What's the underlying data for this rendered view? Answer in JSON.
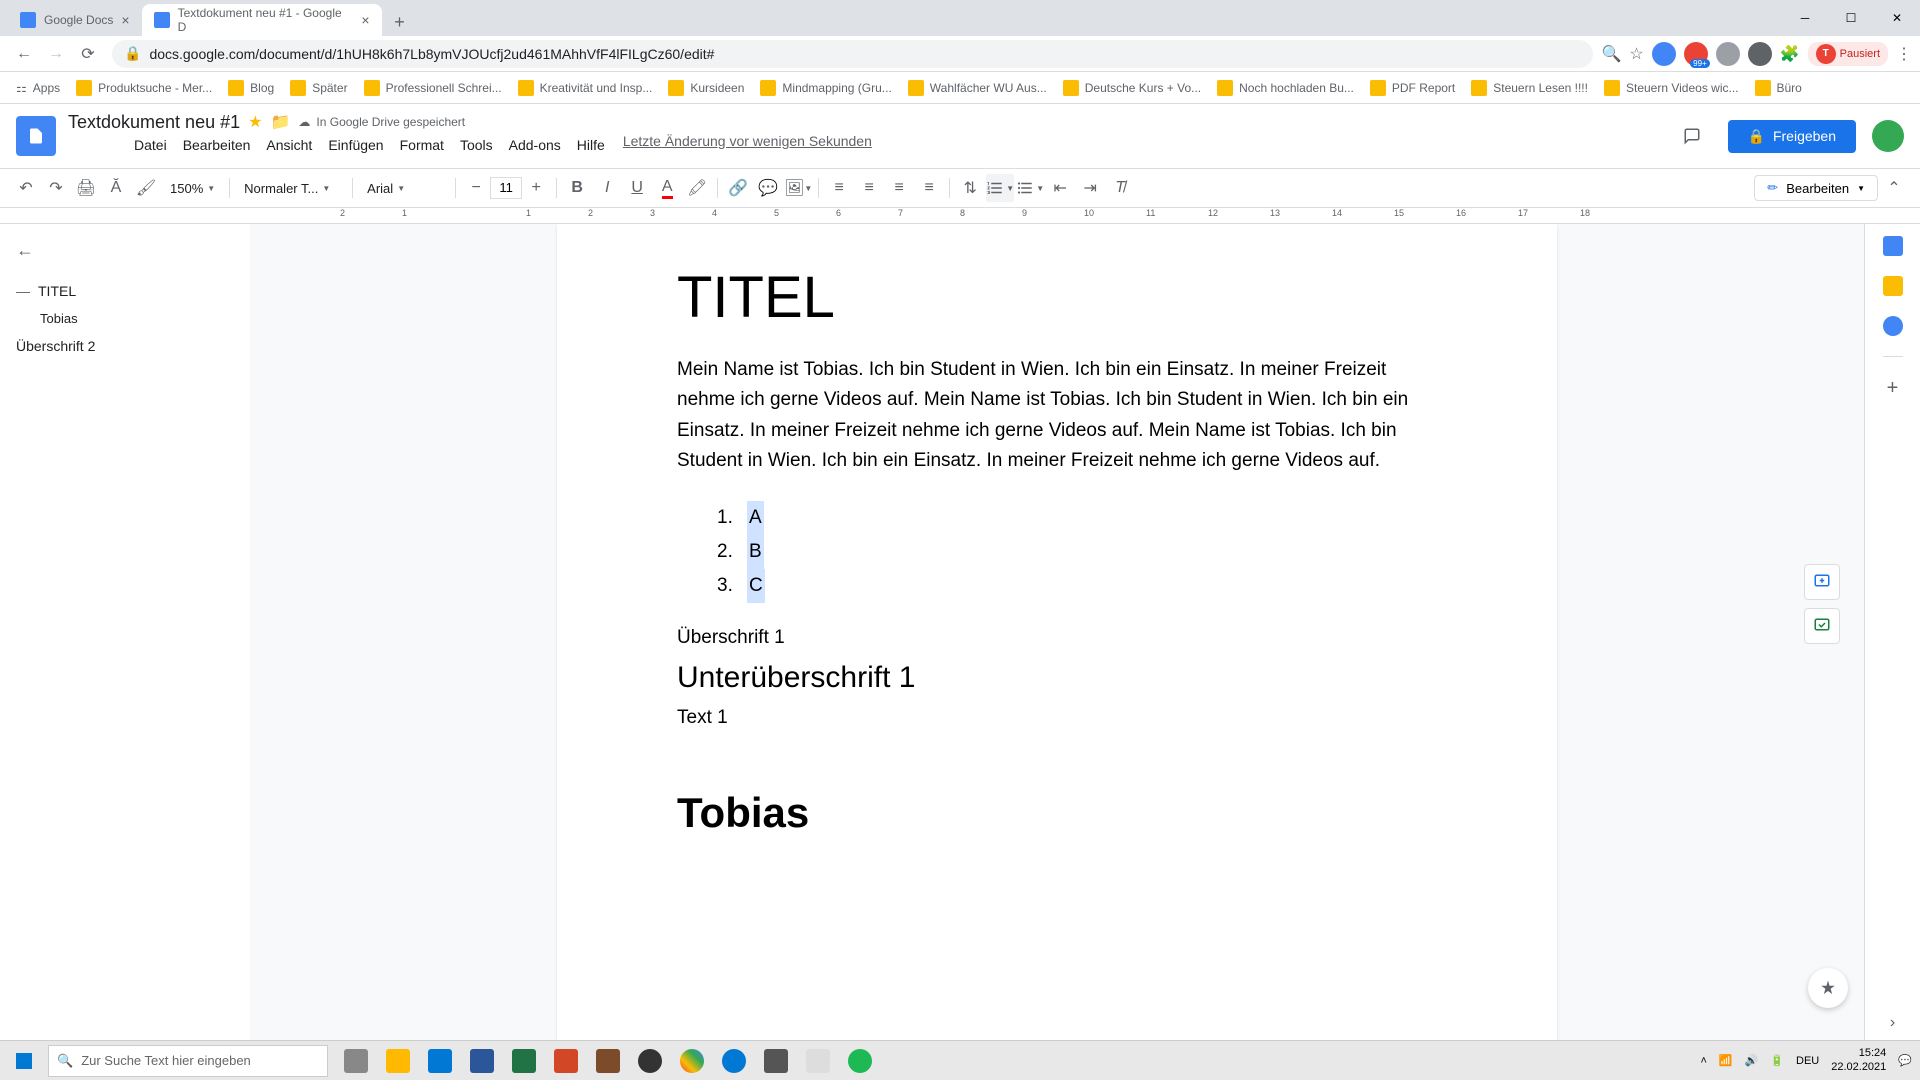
{
  "browser": {
    "tabs": [
      {
        "title": "Google Docs",
        "active": false
      },
      {
        "title": "Textdokument neu #1 - Google D",
        "active": true
      }
    ],
    "url": "docs.google.com/document/d/1hUH8k6h7Lb8ymVJOUcfj2ud461MAhhVfF4lFILgCz60/edit#",
    "pause_label": "Pausiert",
    "pause_initial": "T"
  },
  "bookmarks": [
    "Apps",
    "Produktsuche - Mer...",
    "Blog",
    "Später",
    "Professionell Schrei...",
    "Kreativität und Insp...",
    "Kursideen",
    "Mindmapping (Gru...",
    "Wahlfächer WU Aus...",
    "Deutsche Kurs + Vo...",
    "Noch hochladen Bu...",
    "PDF Report",
    "Steuern Lesen !!!!",
    "Steuern Videos wic...",
    "Büro"
  ],
  "docs": {
    "title": "Textdokument neu #1",
    "save_status": "In Google Drive gespeichert",
    "share_label": "Freigeben",
    "menus": [
      "Datei",
      "Bearbeiten",
      "Ansicht",
      "Einfügen",
      "Format",
      "Tools",
      "Add-ons",
      "Hilfe"
    ],
    "last_change": "Letzte Änderung vor wenigen Sekunden"
  },
  "toolbar": {
    "zoom": "150%",
    "style": "Normaler T...",
    "font": "Arial",
    "size": "11",
    "edit_mode": "Bearbeiten"
  },
  "ruler": [
    "2",
    "1",
    "",
    "1",
    "2",
    "3",
    "4",
    "5",
    "6",
    "7",
    "8",
    "9",
    "10",
    "11",
    "12",
    "13",
    "14",
    "15",
    "16",
    "17",
    "18"
  ],
  "outline": {
    "items": [
      {
        "label": "TITEL",
        "level": 1
      },
      {
        "label": "Tobias",
        "level": 2
      },
      {
        "label": "Überschrift 2",
        "level": 1
      }
    ]
  },
  "document": {
    "title": "TITEL",
    "paragraph": "Mein Name ist Tobias. Ich bin Student in Wien. Ich bin ein Einsatz. In meiner Freizeit nehme ich gerne Videos auf. Mein Name ist Tobias. Ich bin Student in Wien. Ich bin ein Einsatz. In meiner Freizeit nehme ich gerne Videos auf. Mein Name ist Tobias. Ich bin Student in Wien. Ich bin ein Einsatz. In meiner Freizeit nehme ich gerne Videos auf.",
    "list": [
      "A",
      "B",
      "C"
    ],
    "sub1": "Überschrift 1",
    "h2": "Unterüberschrift 1",
    "text1": "Text 1",
    "tobias": "Tobias"
  },
  "taskbar": {
    "search_placeholder": "Zur Suche Text hier eingeben",
    "lang": "DEU",
    "time": "15:24",
    "date": "22.02.2021"
  }
}
